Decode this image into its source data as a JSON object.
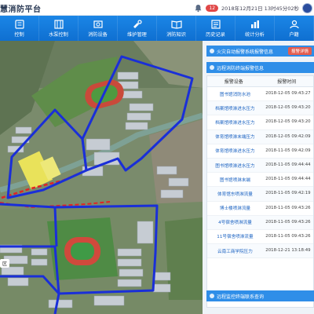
{
  "header": {
    "title": "慧消防平台",
    "badge_count": "12",
    "datetime": "2018年12月21日 13时45分02秒"
  },
  "nav": {
    "items": [
      {
        "label": "控制",
        "icon": "control-icon"
      },
      {
        "label": "水泵控制",
        "icon": "water-pump-icon"
      },
      {
        "label": "消防设备",
        "icon": "fire-equipment-icon"
      },
      {
        "label": "维护管理",
        "icon": "maintenance-icon"
      },
      {
        "label": "消防知识",
        "icon": "knowledge-icon"
      },
      {
        "label": "历史记录",
        "icon": "history-icon"
      },
      {
        "label": "统计分析",
        "icon": "statistics-icon"
      },
      {
        "label": "户籍",
        "icon": "register-icon"
      }
    ]
  },
  "map": {
    "label": "区"
  },
  "panel": {
    "fire_alarm_bar": "火灾自动报警系统报警信息",
    "fire_alarm_button": "报警详情",
    "remote_bar": "远程消防终端报警信息",
    "bottom_bar": "远程监控终端联系查询",
    "table": {
      "headers": [
        "报警设备",
        "报警时间"
      ],
      "rows": [
        {
          "device": "图书馆消防水池",
          "time": "2018-12-05 09:43:27"
        },
        {
          "device": "档案馆喷淋进水压力",
          "time": "2018-12-05 09:43:20"
        },
        {
          "device": "档案馆喷淋进水压力",
          "time": "2018-12-05 09:43:20"
        },
        {
          "device": "体育馆喷淋末端压力",
          "time": "2018-12-05 09:42:09"
        },
        {
          "device": "体育馆喷淋进水压力",
          "time": "2018-11-05 09:42:09"
        },
        {
          "device": "图书馆喷淋进水压力",
          "time": "2018-11-05 09:44:44"
        },
        {
          "device": "图书馆喷淋末端",
          "time": "2018-11-05 09:44:44"
        },
        {
          "device": "体育馆东喷淋流量",
          "time": "2018-11-05 09:42:19"
        },
        {
          "device": "博士楼喷淋流量",
          "time": "2018-11-05 09:43:26"
        },
        {
          "device": "4号宿舍喷淋流量",
          "time": "2018-11-05 09:43:26"
        },
        {
          "device": "11号宿舍喷淋流量",
          "time": "2018-11-05 09:43:26"
        },
        {
          "device": "云南工商学院压力",
          "time": "2018-12-21 13:18:49"
        }
      ]
    }
  },
  "colors": {
    "nav_bg": "#1b86e6",
    "panel_bar": "#2f8ee8",
    "alert_button": "#e45c4d",
    "boundary_line": "#1a2fd8",
    "pipeline_line": "#e02424"
  }
}
